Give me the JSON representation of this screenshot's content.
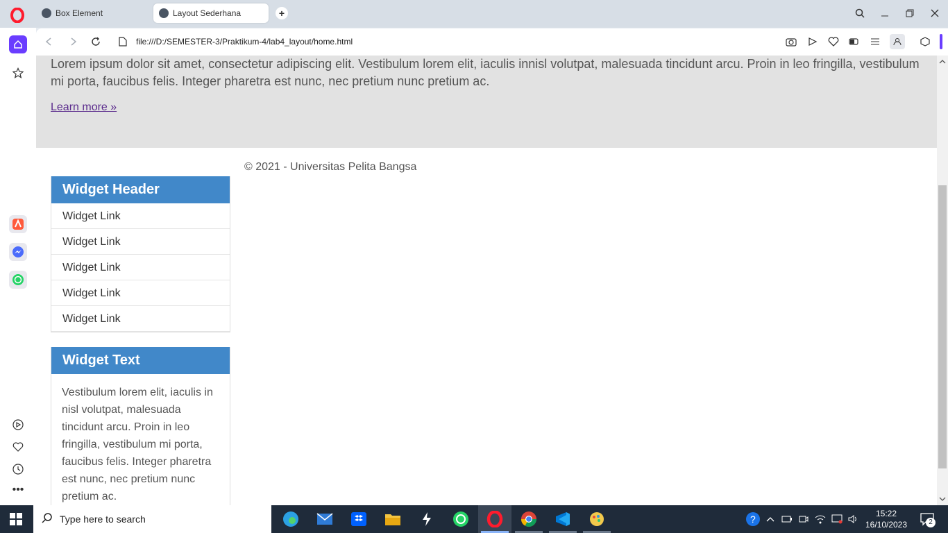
{
  "browser": {
    "tabs": [
      {
        "title": "Box Element",
        "active": false
      },
      {
        "title": "Layout Sederhana",
        "active": true
      }
    ],
    "url": "file:///D:/SEMESTER-3/Praktikum-4/lab4_layout/home.html"
  },
  "page": {
    "hero_text": "Lorem ipsum dolor sit amet, consectetur adipiscing elit. Vestibulum lorem elit, iaculis innisl volutpat, malesuada tincidunt arcu. Proin in leo fringilla, vestibulum mi porta, faucibus felis. Integer pharetra est nunc, nec pretium nunc pretium ac.",
    "learn_more": "Learn more »",
    "footer": "© 2021 - Universitas Pelita Bangsa",
    "widget_links": {
      "header": "Widget Header",
      "links": [
        "Widget Link",
        "Widget Link",
        "Widget Link",
        "Widget Link",
        "Widget Link"
      ]
    },
    "widget_text": {
      "header": "Widget Text",
      "body": "Vestibulum lorem elit, iaculis in nisl volutpat, malesuada tincidunt arcu. Proin in leo fringilla, vestibulum mi porta, faucibus felis. Integer pharetra est nunc, nec pretium nunc pretium ac."
    },
    "colors": {
      "widget_header_bg": "#4188c9",
      "hero_bg": "#e2e2e2"
    }
  },
  "taskbar": {
    "search_placeholder": "Type here to search",
    "time": "15:22",
    "date": "16/10/2023",
    "notification_count": "2"
  }
}
